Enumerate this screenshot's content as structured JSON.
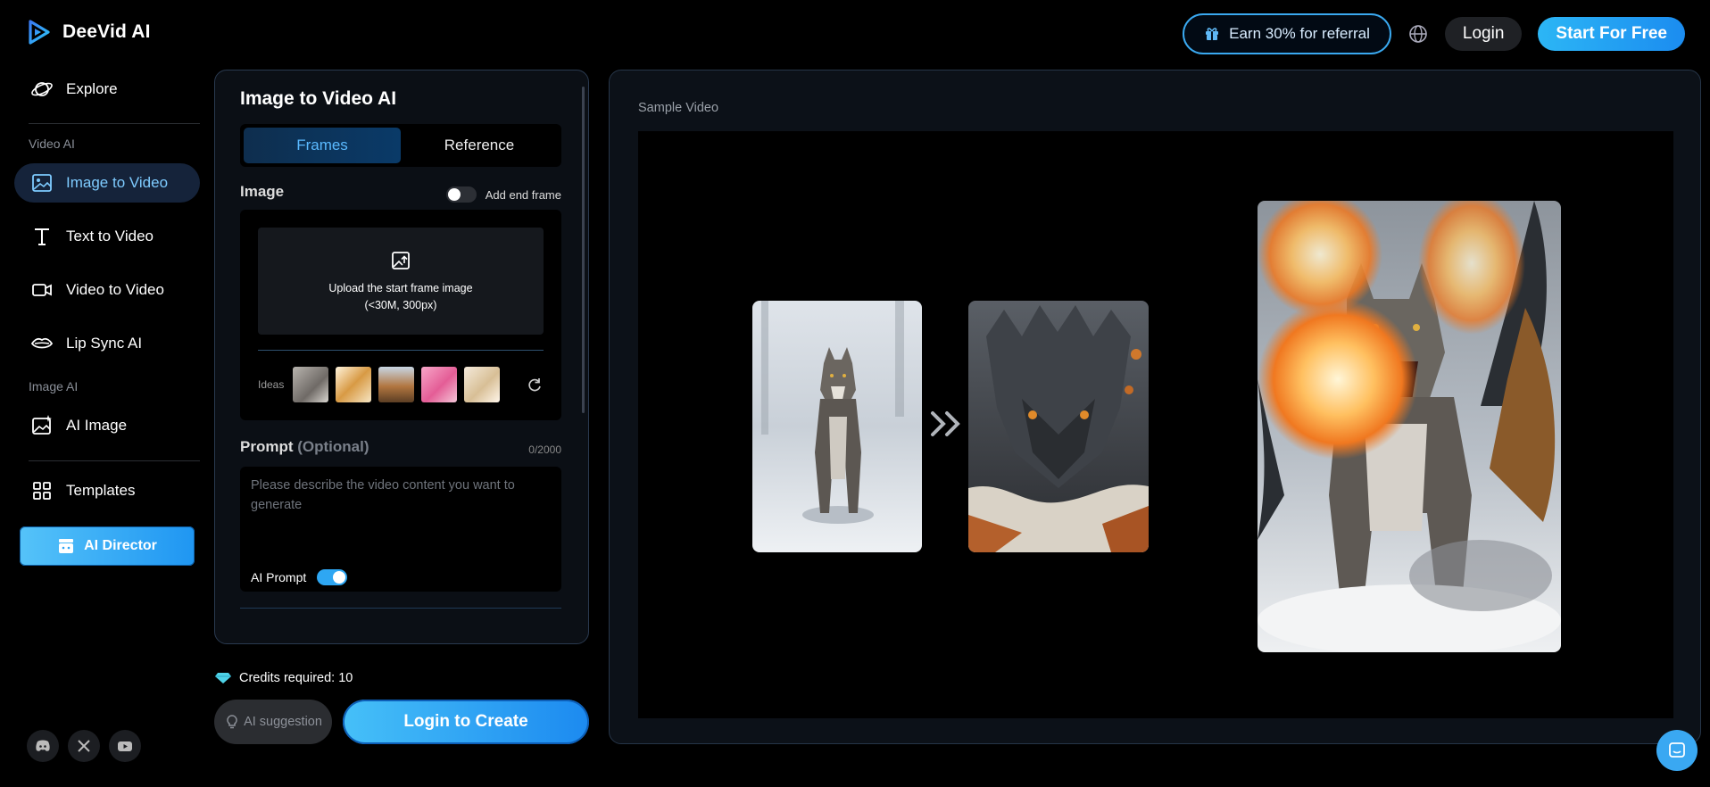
{
  "app": {
    "name": "DeeVid AI"
  },
  "header": {
    "referral_label": "Earn 30% for referral",
    "login_label": "Login",
    "start_label": "Start For Free"
  },
  "sidebar": {
    "explore": "Explore",
    "section_video": "Video AI",
    "image_to_video": "Image to Video",
    "text_to_video": "Text to Video",
    "video_to_video": "Video to Video",
    "lip_sync": "Lip Sync AI",
    "section_image": "Image AI",
    "ai_image": "AI Image",
    "templates": "Templates",
    "ai_director": "AI Director"
  },
  "form": {
    "title": "Image to Video AI",
    "tabs": [
      "Frames",
      "Reference"
    ],
    "active_tab": "Frames",
    "image_label": "Image",
    "end_frame_label": "Add end frame",
    "end_frame_enabled": false,
    "upload_line1": "Upload the start frame image",
    "upload_line2": "(<30M, 300px)",
    "ideas_label": "Ideas",
    "prompt_label": "Prompt",
    "prompt_optional": "(Optional)",
    "prompt_counter": "0/2000",
    "prompt_placeholder": "Please describe the video content you want to generate",
    "ai_prompt_label": "AI Prompt",
    "ai_prompt_enabled": true
  },
  "actions": {
    "credits": "Credits required: 10",
    "suggestion": "AI suggestion",
    "create": "Login to Create"
  },
  "preview": {
    "label": "Sample Video"
  },
  "colors": {
    "accent": "#2ea7f3",
    "active_nav_bg": "#15233a",
    "panel_border": "#2a3a50"
  }
}
